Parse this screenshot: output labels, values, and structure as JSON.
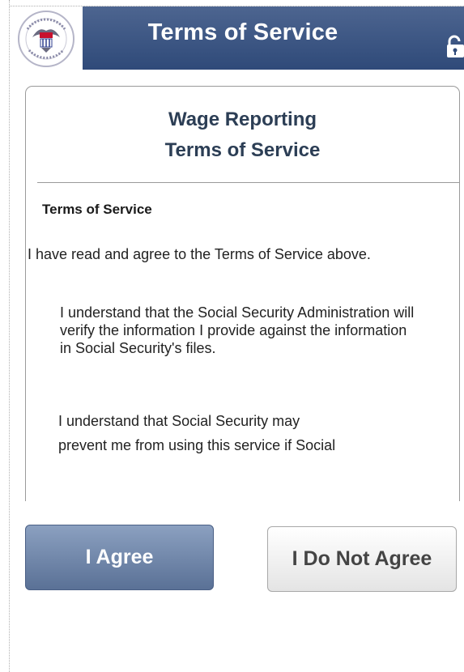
{
  "header": {
    "title": "Terms of Service",
    "logo_icon": "ssa-seal-icon",
    "lock_icon": "lock-icon",
    "colors": {
      "bar": "#3a5483"
    }
  },
  "card": {
    "title_line1": "Wage Reporting",
    "title_line2": "Terms of Service",
    "section_heading": "Terms of Service",
    "intro": "I have read and agree to the Terms of Service above.",
    "paragraph1": "I understand that the Social Security Administration will verify the information I provide against the information in Social Security's files.",
    "paragraph2_line1": "I understand that Social Security may",
    "paragraph2_line2": "prevent me from using this service if Social"
  },
  "buttons": {
    "agree_label": "I Agree",
    "disagree_label": "I Do Not Agree",
    "colors": {
      "agree": "#6f85aa",
      "disagree": "#f0f0f0"
    }
  }
}
